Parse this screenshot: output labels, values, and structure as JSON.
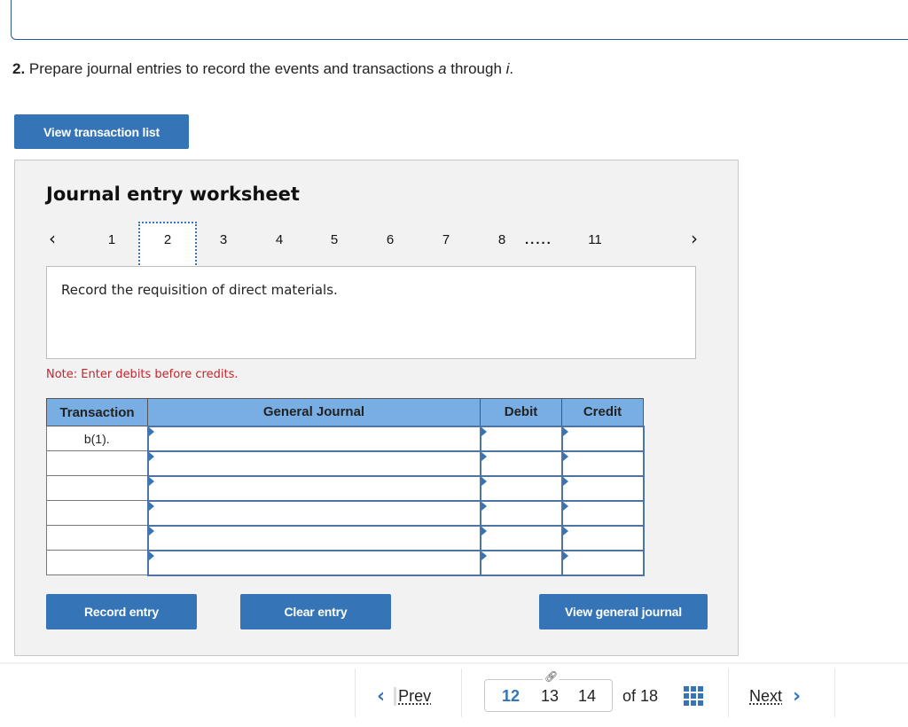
{
  "question": {
    "number": "2.",
    "text_before": " Prepare journal entries to record the events and transactions ",
    "italic_a": "a",
    "text_middle": " through ",
    "italic_i": "i",
    "text_end": "."
  },
  "buttons": {
    "view_transaction_list": "View transaction list",
    "record_entry": "Record entry",
    "clear_entry": "Clear entry",
    "view_general_journal": "View general journal"
  },
  "worksheet": {
    "title": "Journal entry worksheet",
    "pager": {
      "prev_icon": "‹",
      "next_icon": "›",
      "pages": [
        "1",
        "2",
        "3",
        "4",
        "5",
        "6",
        "7",
        "8"
      ],
      "ellipsis": ".....",
      "last_page": "11",
      "active_page": "2"
    },
    "description": "Record the requisition of direct materials.",
    "note": "Note: Enter debits before credits.",
    "table": {
      "headers": [
        "Transaction",
        "General Journal",
        "Debit",
        "Credit"
      ],
      "rows": [
        {
          "transaction": "b(1).",
          "account": "",
          "debit": "",
          "credit": ""
        },
        {
          "transaction": "",
          "account": "",
          "debit": "",
          "credit": ""
        },
        {
          "transaction": "",
          "account": "",
          "debit": "",
          "credit": ""
        },
        {
          "transaction": "",
          "account": "",
          "debit": "",
          "credit": ""
        },
        {
          "transaction": "",
          "account": "",
          "debit": "",
          "credit": ""
        },
        {
          "transaction": "",
          "account": "",
          "debit": "",
          "credit": ""
        }
      ]
    }
  },
  "footer": {
    "prev_label": "Prev",
    "next_label": "Next",
    "pages": [
      "12",
      "13",
      "14"
    ],
    "current_page": "12",
    "of_total": "of 18",
    "icons": {
      "prev": "chevron-left-icon",
      "next": "chevron-right-icon",
      "link": "link-icon",
      "grid": "grid-icon"
    }
  },
  "colors": {
    "accent": "#3575b7",
    "table_header": "#78aee3",
    "note": "#c0272d",
    "panel_bg": "#f2f2f2"
  }
}
